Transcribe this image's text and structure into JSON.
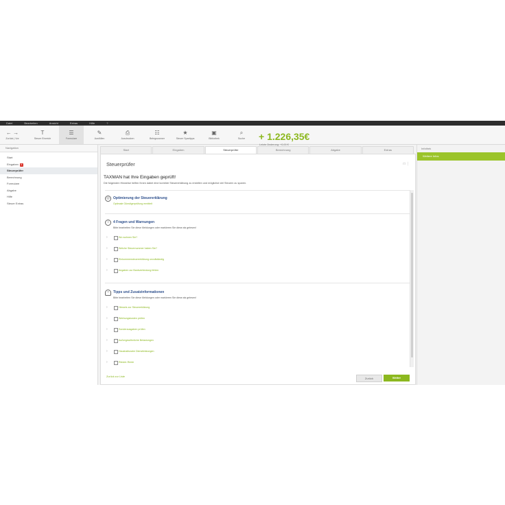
{
  "menubar": [
    "Datei",
    "Bearbeiten",
    "Ansicht",
    "Extras",
    "Hilfe",
    "?"
  ],
  "toolbar": {
    "tools": [
      {
        "icon": "← →",
        "label": "Zurück | Vor"
      },
      {
        "icon": "T",
        "label": "Steuer Einreich"
      },
      {
        "icon": "☰",
        "label": "Formulare"
      },
      {
        "icon": "✎",
        "label": "Ausfüllen"
      },
      {
        "icon": "⎙",
        "label": "Ausdrucken"
      },
      {
        "icon": "☷",
        "label": "Belegscanner"
      },
      {
        "icon": "★",
        "label": "Steuer Spartipps"
      },
      {
        "icon": "▣",
        "label": "Bibliothek"
      },
      {
        "icon": "⌕",
        "label": "Suche"
      }
    ],
    "amount": "+ 1.226,35€",
    "amount_sub": "Letzte Änderung: +0,00 €"
  },
  "left_panel": {
    "header": "Navigation",
    "items": [
      {
        "label": "Start"
      },
      {
        "label": "Eingaben",
        "badge": "4"
      },
      {
        "label": "Steuerprüfer"
      },
      {
        "label": "Berechnung"
      },
      {
        "label": "Formulare"
      },
      {
        "label": "Abgabe"
      },
      {
        "label": "Hilfe"
      },
      {
        "label": "Steuer Extras"
      }
    ]
  },
  "tabs": [
    "Start",
    "Eingaben",
    "Steuerprüfer",
    "Berechnung",
    "Abgabe",
    "Extras"
  ],
  "main": {
    "page_title": "Steuerprüfer",
    "headline": "TAXMAN hat Ihre Eingaben geprüft!",
    "subline": "Die folgenden Hinweise helfen Ihnen dabei eine korrekte Steuererklärung zu erstellen und möglichst viel Steuern zu sparen.",
    "sections": [
      {
        "title": "Optimierung der Steuererklärung",
        "link": "Optimale Günstigerprüfung ermittelt",
        "items": []
      },
      {
        "title": "4 Fragen und Warnungen",
        "desc": "Bitte bearbeiten Sie diese Meldungen oder markieren Sie diese als gelesen!",
        "items": [
          "Wo wohnen Sie?",
          "Welche Steuernummer haben Sie?",
          "Einkommensteuererklärung unvollständig",
          "Angaben zur Bankverbindung fehlen"
        ]
      },
      {
        "title": "Tipps und Zusatzinformationen",
        "desc": "Bitte bearbeiten Sie diese Meldungen oder markieren Sie diese als gelesen!",
        "items": [
          "Hinweis zur Steuererklärung",
          "Werbungskosten prüfen",
          "Sonderausgaben prüfen",
          "Außergewöhnliche Belastungen",
          "Haushaltsnahe Dienstleistungen",
          "Riester-Rente"
        ]
      }
    ],
    "bottom_link": "Zurück zur Liste",
    "btn_back": "Zurück",
    "btn_next": "Weiter"
  },
  "right_panel": {
    "header": "Infothek",
    "button": "Weitere Infos"
  },
  "colors": {
    "accent": "#8cb81f",
    "title_blue": "#2d4f8c",
    "menubar": "#2d2d2d",
    "badge": "#d9342b"
  }
}
